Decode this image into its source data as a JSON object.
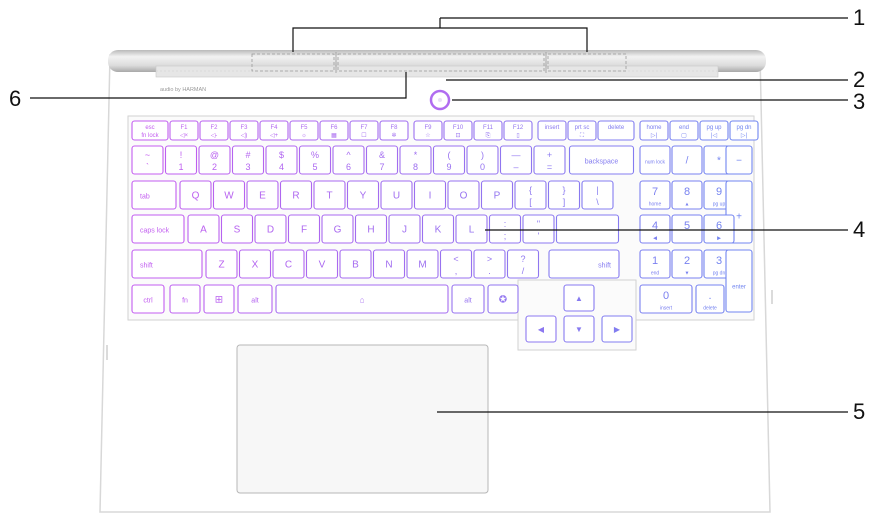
{
  "callouts": [
    {
      "number": "1",
      "target": "speakers"
    },
    {
      "number": "2",
      "target": "camera"
    },
    {
      "number": "3",
      "target": "power-button"
    },
    {
      "number": "4",
      "target": "keyboard"
    },
    {
      "number": "5",
      "target": "touchpad"
    },
    {
      "number": "6",
      "target": "speaker-branding"
    }
  ],
  "branding_text": "audio by HARMAN",
  "colors": {
    "key_left": "#c65cf0",
    "key_right": "#6f86f0",
    "chassis_edge": "#d9d9d9",
    "line": "#111111"
  },
  "keyboard": {
    "row_fn": [
      {
        "main": "esc",
        "sub": "fn lock"
      },
      {
        "main": "F1",
        "sub": "◁×"
      },
      {
        "main": "F2",
        "sub": "◁-"
      },
      {
        "main": "F3",
        "sub": "◁)"
      },
      {
        "main": "F4",
        "sub": "◁+"
      },
      {
        "main": "F5",
        "sub": "☼"
      },
      {
        "main": "F6",
        "sub": "▦"
      },
      {
        "main": "F7",
        "sub": "☐"
      },
      {
        "main": "F8",
        "sub": "✲"
      },
      {
        "main": "F9",
        "sub": "☆"
      },
      {
        "main": "F10",
        "sub": "⊡"
      },
      {
        "main": "F11",
        "sub": "⎘"
      },
      {
        "main": "F12",
        "sub": "▯"
      },
      {
        "main": "insert",
        "sub": ""
      },
      {
        "main": "prt sc",
        "sub": "⛶"
      },
      {
        "main": "delete",
        "sub": ""
      },
      {
        "main": "home",
        "sub": "▷|"
      },
      {
        "main": "end",
        "sub": "▢"
      },
      {
        "main": "pg up",
        "sub": "|◁"
      },
      {
        "main": "pg dn",
        "sub": "▷|"
      }
    ],
    "row_num": [
      {
        "top": "~",
        "bottom": "`"
      },
      {
        "top": "!",
        "bottom": "1"
      },
      {
        "top": "@",
        "bottom": "2"
      },
      {
        "top": "#",
        "bottom": "3"
      },
      {
        "top": "$",
        "bottom": "4"
      },
      {
        "top": "%",
        "bottom": "5"
      },
      {
        "top": "^",
        "bottom": "6"
      },
      {
        "top": "&",
        "bottom": "7"
      },
      {
        "top": "*",
        "bottom": "8"
      },
      {
        "top": "(",
        "bottom": "9"
      },
      {
        "top": ")",
        "bottom": "0"
      },
      {
        "top": "—",
        "bottom": "–"
      },
      {
        "top": "+",
        "bottom": "="
      }
    ],
    "backspace": "backspace",
    "numlock": "num lock",
    "np_div": "/",
    "np_mul": "*",
    "np_minus": "−",
    "tab": "tab",
    "row_q": [
      "Q",
      "W",
      "E",
      "R",
      "T",
      "Y",
      "U",
      "I",
      "O",
      "P"
    ],
    "row_q_sym": [
      {
        "top": "{",
        "bottom": "["
      },
      {
        "top": "}",
        "bottom": "]"
      },
      {
        "top": "|",
        "bottom": "\\"
      }
    ],
    "np_row7": [
      {
        "main": "7",
        "sub": "home"
      },
      {
        "main": "8",
        "sub": "▲"
      },
      {
        "main": "9",
        "sub": "pg up"
      }
    ],
    "np_plus": "+",
    "capslock": "caps lock",
    "row_a": [
      "A",
      "S",
      "D",
      "F",
      "G",
      "H",
      "J",
      "K",
      "L"
    ],
    "row_a_sym": [
      {
        "top": ":",
        "bottom": ";"
      },
      {
        "top": "\"",
        "bottom": "'"
      }
    ],
    "np_row4": [
      {
        "main": "4",
        "sub": "◀"
      },
      {
        "main": "5",
        "sub": ""
      },
      {
        "main": "6",
        "sub": "▶"
      }
    ],
    "shift_left": "shift",
    "row_z": [
      "Z",
      "X",
      "C",
      "V",
      "B",
      "N",
      "M"
    ],
    "row_z_sym": [
      {
        "top": "<",
        "bottom": ","
      },
      {
        "top": ">",
        "bottom": "."
      },
      {
        "top": "?",
        "bottom": "/"
      }
    ],
    "shift_right": "shift",
    "np_row1": [
      {
        "main": "1",
        "sub": "end"
      },
      {
        "main": "2",
        "sub": "▼"
      },
      {
        "main": "3",
        "sub": "pg dn"
      }
    ],
    "np_enter": "enter",
    "ctrl": "ctrl",
    "fn": "fn",
    "win": "⊞",
    "alt_left": "alt",
    "space": "⌂",
    "alt_right": "alt",
    "copilot": "✪",
    "np_0": {
      "main": "0",
      "sub": "insert"
    },
    "np_dot": {
      "main": ".",
      "sub": "delete"
    },
    "arrows": {
      "up": "▲",
      "left": "◀",
      "down": "▼",
      "right": "▶"
    }
  }
}
